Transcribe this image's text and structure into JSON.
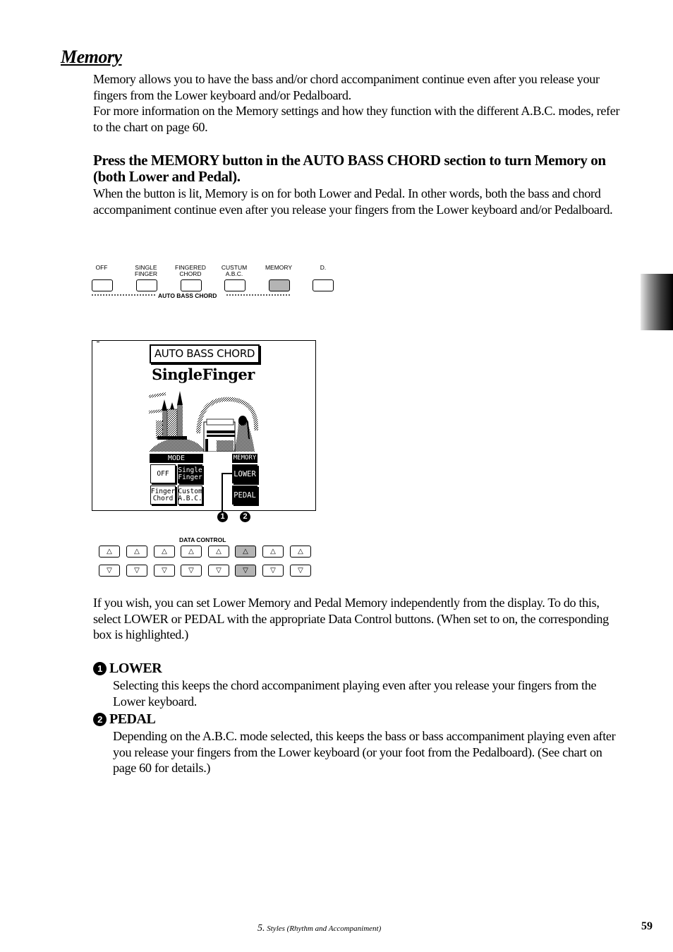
{
  "page": {
    "title": "Memory",
    "intro": [
      "Memory allows you to have the bass and/or chord accompaniment continue even after you release your fingers from the Lower keyboard and/or Pedalboard.",
      "For more information on the Memory settings and how they function with the different A.B.C. modes, refer to the chart on page 60."
    ],
    "instruction_heading": "Press the MEMORY button in the AUTO BASS CHORD section to turn Memory on (both Lower and Pedal).",
    "instruction_body": "When the button is lit, Memory is on for both Lower and Pedal.  In other words, both the bass and chord accompaniment continue even after you release your fingers from the Lower keyboard and/or Pedalboard.",
    "independent_text": "If you wish, you can set Lower Memory and Pedal Memory independently from the display.  To do this, select LOWER or PEDAL with the appropriate Data Control buttons.  (When set to on, the corresponding box is highlighted.)",
    "items": [
      {
        "number": "1",
        "title": "LOWER",
        "text": "Selecting this keeps the chord accompaniment playing even after you release your fingers from the Lower keyboard."
      },
      {
        "number": "2",
        "title": "PEDAL",
        "text": "Depending on the A.B.C. mode selected, this keeps the bass or bass accompaniment playing even after you release your fingers from the Lower keyboard (or your foot from the Pedalboard).  (See chart on page 60 for details.)"
      }
    ]
  },
  "abc_panel": {
    "section_label": "AUTO BASS CHORD",
    "buttons": [
      {
        "label": "OFF",
        "lit": false
      },
      {
        "label": "SINGLE FINGER",
        "lit": false
      },
      {
        "label": "FINGERED CHORD",
        "lit": false
      },
      {
        "label": "CUSTUM A.B.C.",
        "lit": false
      },
      {
        "label": "MEMORY",
        "lit": true
      },
      {
        "label": "D.",
        "lit": false
      }
    ],
    "highlight_color": "#b4b4b4"
  },
  "lcd": {
    "title": "AUTO BASS CHORD",
    "subtitle": "SingleFinger",
    "mode_header": "MODE",
    "memory_header": "MEMORY",
    "mode_options": [
      {
        "label": "OFF",
        "selected": false
      },
      {
        "label": "Single Finger",
        "selected": true
      },
      {
        "label": "Finger Chord",
        "selected": false
      },
      {
        "label": "Custom A.B.C.",
        "selected": false
      }
    ],
    "memory_options": [
      {
        "label": "LOWER",
        "on": true
      },
      {
        "label": "PEDAL",
        "on": true
      }
    ],
    "callouts": [
      "1",
      "2"
    ]
  },
  "data_control": {
    "label": "DATA CONTROL",
    "up_symbol": "△",
    "down_symbol": "▽",
    "count": 8,
    "highlighted_index": 5
  },
  "footer": {
    "chapter_number": "5.",
    "chapter_title": "Styles (Rhythm and Accompaniment)",
    "page_number": "59"
  }
}
